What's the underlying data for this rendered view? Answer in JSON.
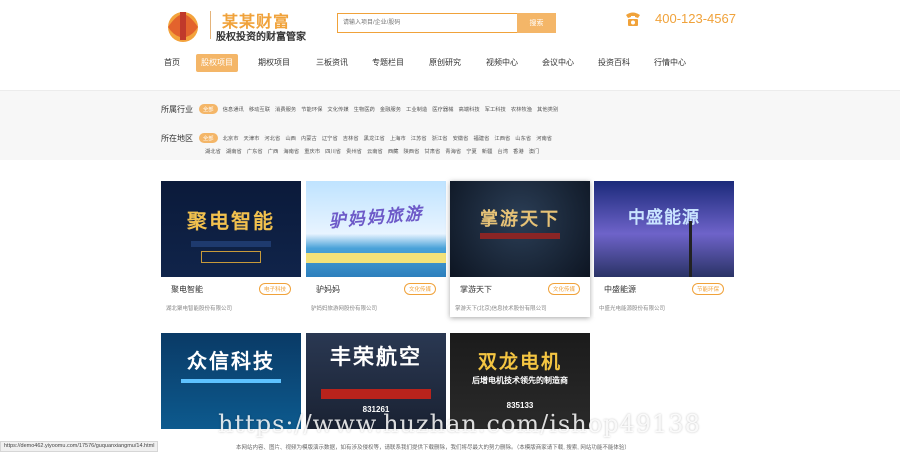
{
  "header": {
    "brand_name": "某某财富",
    "slogan": "股权投资的财富管家",
    "search_placeholder": "请输入项目/企业/股码",
    "search_button": "搜索",
    "phone": "400-123-4567"
  },
  "nav": {
    "items": [
      {
        "label": "首页"
      },
      {
        "label": "股权项目"
      },
      {
        "label": "期权项目"
      },
      {
        "label": "三板资讯"
      },
      {
        "label": "专题栏目"
      },
      {
        "label": "原创研究"
      },
      {
        "label": "视频中心"
      },
      {
        "label": "会议中心"
      },
      {
        "label": "投资百科"
      },
      {
        "label": "行情中心"
      }
    ]
  },
  "filters": {
    "industry": {
      "label": "所属行业",
      "items": [
        "全部",
        "信息通讯",
        "移动互联",
        "消费服务",
        "节能环保",
        "文化传媒",
        "生物医药",
        "金融服务",
        "工业制造",
        "医疗器械",
        "高端科技",
        "军工科技",
        "农林牧渔",
        "其他类别"
      ]
    },
    "region": {
      "label": "所在地区",
      "row1": [
        "全部",
        "北京市",
        "天津市",
        "河北省",
        "山西",
        "内蒙古",
        "辽宁省",
        "吉林省",
        "黑龙江省",
        "上海市",
        "江苏省",
        "浙江省",
        "安徽省",
        "福建省",
        "江西省",
        "山东省",
        "河南省"
      ],
      "row2": [
        "湖北省",
        "湖南省",
        "广东省",
        "广西",
        "海南省",
        "重庆市",
        "四川省",
        "贵州省",
        "云南省",
        "西藏",
        "陕西省",
        "甘肃省",
        "青海省",
        "宁夏",
        "新疆",
        "台湾",
        "香港",
        "澳门"
      ]
    }
  },
  "cards": [
    {
      "title": "聚电智能",
      "tag": "电子科技",
      "company": "湖北聚电智能股份有限公司",
      "banner": "聚电智能"
    },
    {
      "title": "驴妈妈",
      "tag": "文化传媒",
      "company": "驴妈妈旅游网股份有限公司",
      "banner": "驴妈妈旅游"
    },
    {
      "title": "掌游天下",
      "tag": "文化传媒",
      "company": "掌游天下(北京)信息技术股份有限公司",
      "banner": "掌游天下"
    },
    {
      "title": "中盛能源",
      "tag": "节能环保",
      "company": "中盛光电能源股份有限公司",
      "banner": "中盛能源"
    },
    {
      "title": "众信科技",
      "tag": "",
      "company": "",
      "banner": "众信科技"
    },
    {
      "title": "丰荣航空",
      "tag": "",
      "company": "",
      "banner": "丰荣航空"
    },
    {
      "title": "双龙电机",
      "tag": "",
      "company": "",
      "banner": "双龙电机"
    }
  ],
  "banner_sub": {
    "card7_sub": "后增电机技术领先的制造商",
    "card7_code": "835133",
    "card6_code": "831261"
  },
  "status_url": "https://demo462.yiyoomu.com/17576/guquanxiangmu/14.html",
  "footer_text": "本网站内容、图片、视频为模版演示数据，如有涉及侵权等，请联系我们提供下载删除，我们将尽最大的努力删除。（本模版商家请下载, 搜索, 网站功能不能体验）",
  "watermark": "https://www.huzhan.com/ishop49138",
  "colors": {
    "accent": "#f4b668",
    "accent_text": "#f0a23a"
  }
}
